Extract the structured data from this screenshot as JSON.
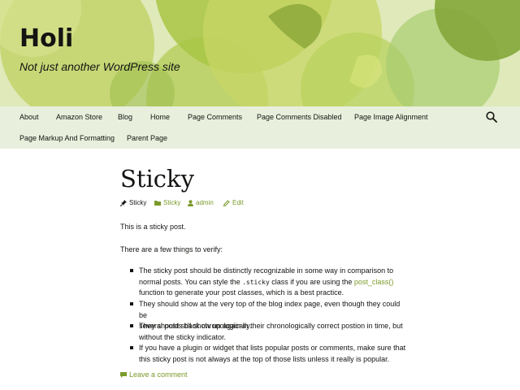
{
  "header": {
    "site_title": "Holi",
    "tagline": "Not just another WordPress site"
  },
  "nav": {
    "items": [
      {
        "label": "About"
      },
      {
        "label": "Amazon Store"
      },
      {
        "label": "Blog"
      },
      {
        "label": "Home"
      },
      {
        "label": "Page Comments"
      },
      {
        "label": "Page Comments Disabled"
      },
      {
        "label": "Page Image Alignment"
      },
      {
        "label": "Page Markup And Formatting"
      },
      {
        "label": "Parent Page"
      }
    ]
  },
  "post": {
    "title": "Sticky",
    "meta": {
      "sticky_label": "Sticky",
      "category": "Sticky",
      "author": "admin",
      "edit": "Edit"
    },
    "intro": "This is a sticky post.",
    "verify": "There are a few things to verify:",
    "list": {
      "item1_a": "The sticky post should be distinctly recognizable in some way in comparison to",
      "item1_b": "normal posts. You can style the ",
      "item1_code": ".sticky",
      "item1_c": " class if you are using the ",
      "item1_link": "post_class()",
      "item1_d": "function to generate your post classes, which is a best practice.",
      "item2_a": "They should show at the very top of the blog index page, even though they could be",
      "item2_b": "several posts back chronologically.",
      "item3_a": "They should still show up again in their chronologically correct postion in time, but",
      "item3_b": "without the sticky indicator.",
      "item4_a": "If you have a plugin or widget that lists popular posts or comments, make sure that",
      "item4_b": "this sticky post is not always at the top of those lists unless it really is popular."
    },
    "comment_link": "Leave a comment"
  },
  "colors": {
    "link": "#7a9a2a",
    "nav_bg": "#e8efdc",
    "text": "#141412"
  },
  "icons": {
    "search": "search-icon",
    "pin": "pin-icon",
    "folder": "folder-icon",
    "user": "user-icon",
    "edit": "pencil-icon",
    "comment": "comment-icon"
  }
}
